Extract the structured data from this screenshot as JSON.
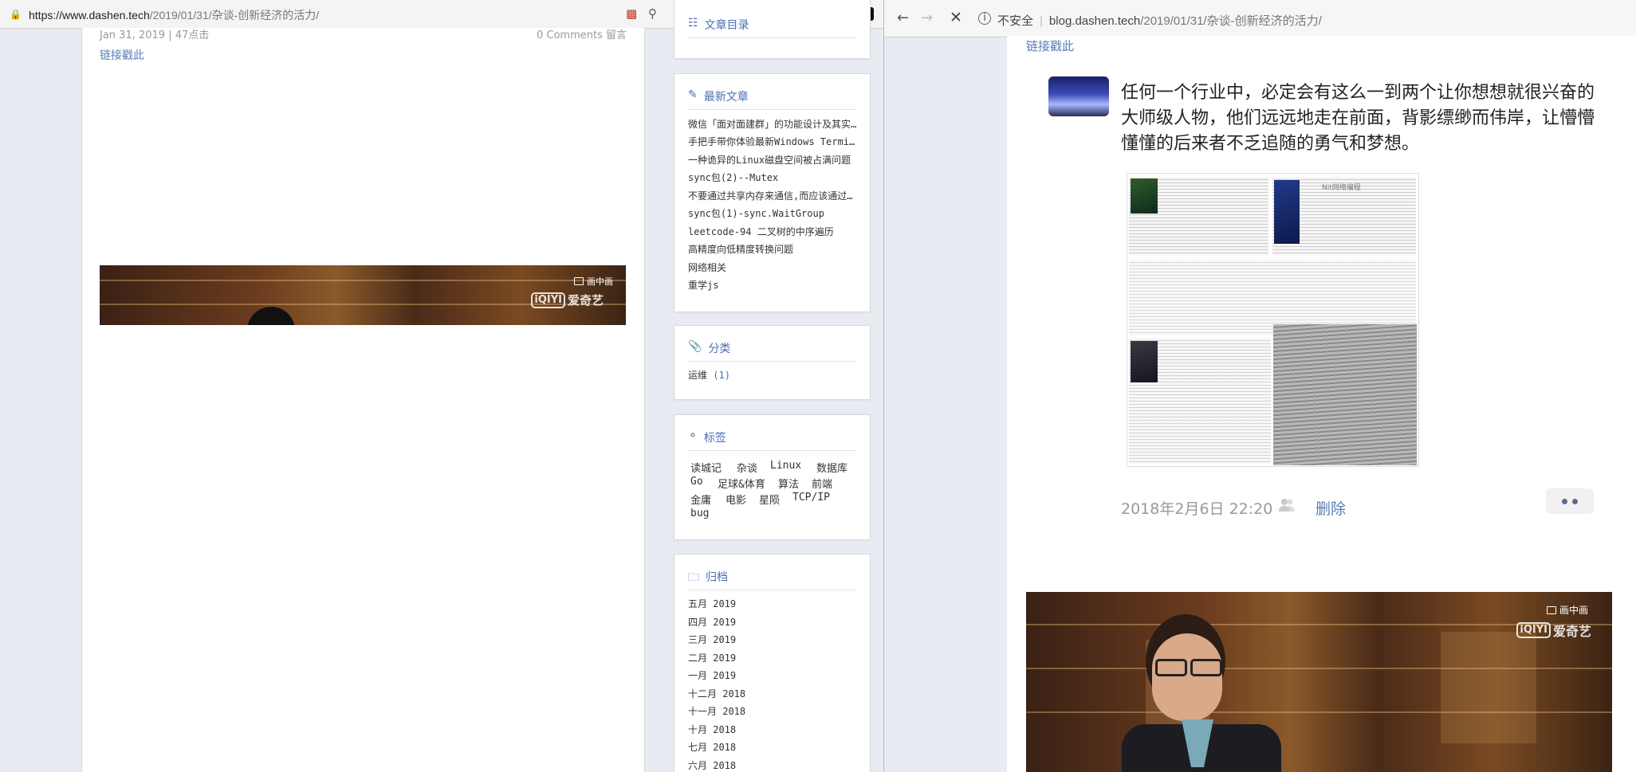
{
  "left_browser": {
    "url_base": "https://www.dashen.tech",
    "url_path": "/2019/01/31/杂谈-创新经济的活力/",
    "article": {
      "meta_cut_left": "Jan 31, 2019 | 47点击",
      "meta_cut_right": "0 Comments 留言",
      "permalink": "链接戳此",
      "video_overlay": {
        "pip_label": "画中画",
        "brand": "爱奇艺",
        "brand_mark": "iQIYI"
      }
    },
    "sidebar": {
      "toc_title": "文章目录",
      "recent_title": "最新文章",
      "recent_posts": [
        "微信「面对面建群」的功能设计及其实现",
        "手把手带你体验最新Windows Terminal",
        "一种诡异的Linux磁盘空间被占满问题",
        "sync包(2)--Mutex",
        "不要通过共享内存来通信,而应该通过通信来共享内存",
        "sync包(1)-sync.WaitGroup",
        "leetcode-94 二叉树的中序遍历",
        "高精度向低精度转换问题",
        "网络相关",
        "重学js"
      ],
      "categories_title": "分类",
      "categories": [
        {
          "name": "运维",
          "count": "(1)"
        }
      ],
      "tags_title": "标签",
      "tags": [
        "读城记",
        "杂谈",
        "Linux",
        "数据库",
        "Go",
        "足球&体育",
        "算法",
        "前端",
        "金庸",
        "电影",
        "星陨",
        "TCP/IP",
        "bug"
      ],
      "archive_title": "归档",
      "archives": [
        "五月 2019",
        "四月 2019",
        "三月 2019",
        "二月 2019",
        "一月 2019",
        "十二月 2018",
        "十一月 2018",
        "十月 2018",
        "七月 2018",
        "六月 2018"
      ]
    }
  },
  "right_browser": {
    "security_label": "不安全",
    "url_base": "blog.dashen.tech",
    "url_path": "/2019/01/31/杂谈-创新经济的活力/",
    "permalink": "链接戳此",
    "quote_text": "任何一个行业中，必定会有这么一到两个让你想想就很兴奋的大师级人物，他们远远地走在前面，背影缥缈而伟岸，让懵懵懂懂的后来者不乏追随的勇气和梦想。",
    "timestamp": "2018年2月6日 22:20",
    "delete_label": "删除",
    "collage_header": "Nit网络编程",
    "video_overlay": {
      "pip_label": "画中画",
      "brand": "爱奇艺",
      "brand_mark": "iQIYI"
    }
  },
  "icons": [
    "lock-icon",
    "zoom-icon",
    "star-icon",
    "back-icon",
    "forward-icon",
    "stop-icon",
    "info-icon",
    "edit-icon",
    "paperclip-icon",
    "tag-icon",
    "folder-icon",
    "user-icon",
    "more-icon"
  ]
}
